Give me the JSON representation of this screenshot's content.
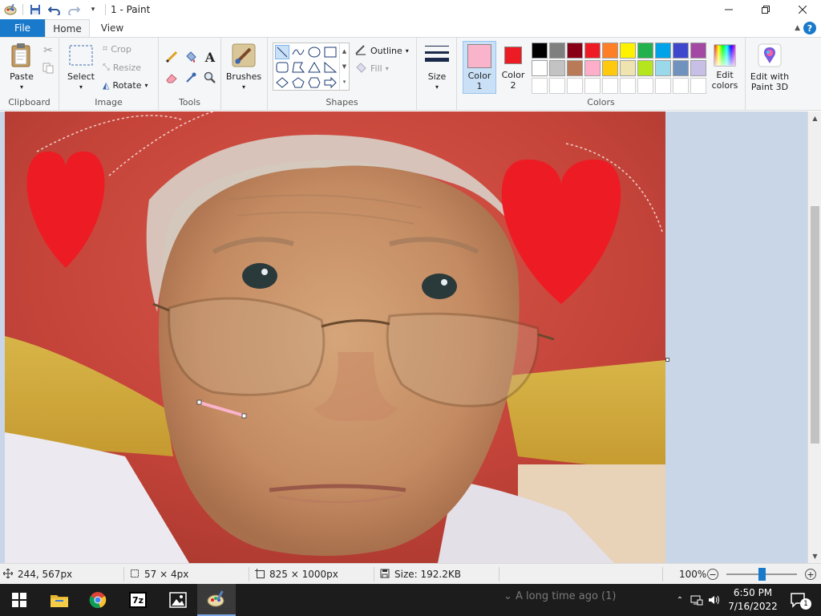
{
  "window": {
    "title": "1 - Paint"
  },
  "tabs": {
    "file": "File",
    "home": "Home",
    "view": "View"
  },
  "ribbon": {
    "clipboard": {
      "paste": "Paste",
      "label": "Clipboard"
    },
    "image": {
      "select": "Select",
      "crop": "Crop",
      "resize": "Resize",
      "rotate": "Rotate",
      "label": "Image"
    },
    "tools": {
      "label": "Tools"
    },
    "brushes": {
      "label": "Brushes"
    },
    "shapes": {
      "outline": "Outline",
      "fill": "Fill",
      "label": "Shapes"
    },
    "size": {
      "label": "Size"
    },
    "colors": {
      "color1": "Color 1",
      "color2": "Color 2",
      "edit_colors": "Edit colors",
      "label": "Colors",
      "color1_value": "#f9b3cb",
      "color2_value": "#ed1c24",
      "palette_row1": [
        "#000000",
        "#7f7f7f",
        "#880015",
        "#ed1c24",
        "#ff7f27",
        "#fff200",
        "#22b14c",
        "#00a2e8",
        "#3f48cc",
        "#a349a4"
      ],
      "palette_row2": [
        "#ffffff",
        "#c3c3c3",
        "#b97a57",
        "#ffaec9",
        "#ffc90e",
        "#efe4b0",
        "#b5e61d",
        "#99d9ea",
        "#7092be",
        "#c8bfe7"
      ],
      "palette_row3": [
        "#ffffff",
        "#ffffff",
        "#ffffff",
        "#ffffff",
        "#ffffff",
        "#ffffff",
        "#ffffff",
        "#ffffff",
        "#ffffff",
        "#ffffff"
      ]
    },
    "paint3d": {
      "label": "Edit with Paint 3D"
    }
  },
  "status": {
    "cursor": "244, 567px",
    "selection": "57 × 4px",
    "image_size": "825 × 1000px",
    "file_size": "Size: 192.2KB",
    "zoom": "100%",
    "zoom_fraction": 0.5
  },
  "taskbar": {
    "time": "6:50 PM",
    "date": "7/16/2022",
    "notifications": "1",
    "behind_text": "A long time ago (1)"
  }
}
